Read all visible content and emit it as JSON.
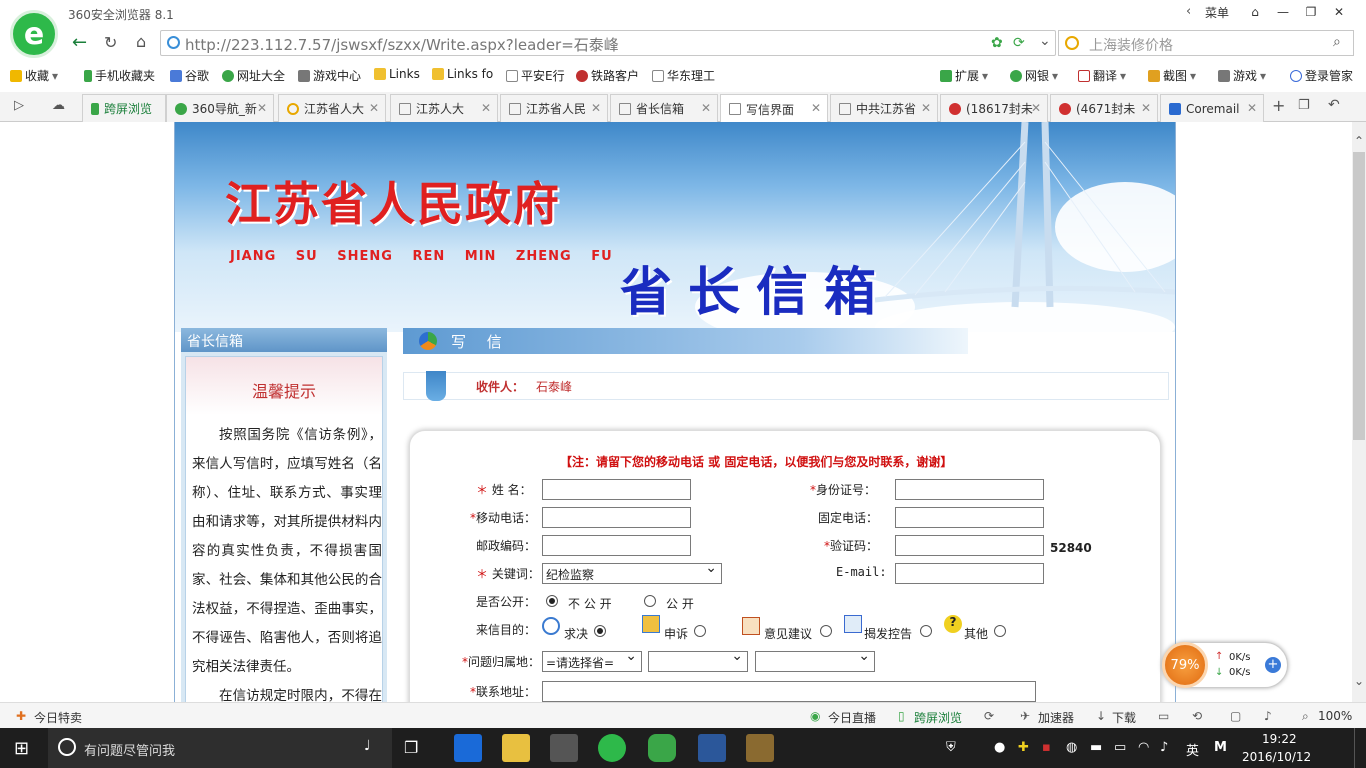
{
  "browser": {
    "app_title": "360安全浏览器 8.1",
    "menu_label": "菜单",
    "url": "http://223.112.7.57/jswsxf/szxx/Write.aspx?leader=石泰峰",
    "search_placeholder": "上海装修价格"
  },
  "bookmarks": {
    "left": [
      "收藏",
      "手机收藏夹",
      "谷歌",
      "网址大全",
      "游戏中心",
      "Links",
      "Links fo",
      "平安E行",
      "铁路客户",
      "华东理工"
    ],
    "right": [
      "扩展",
      "网银",
      "翻译",
      "截图",
      "游戏",
      "登录管家"
    ]
  },
  "tabs": [
    {
      "label": "跨屏浏览",
      "active": false
    },
    {
      "label": "360导航_新",
      "active": false
    },
    {
      "label": "江苏省人大",
      "active": false
    },
    {
      "label": "江苏人大",
      "active": false
    },
    {
      "label": "江苏省人民",
      "active": false
    },
    {
      "label": "省长信箱",
      "active": false
    },
    {
      "label": "写信界面",
      "active": true
    },
    {
      "label": "中共江苏省",
      "active": false
    },
    {
      "label": "(18617封未",
      "active": false
    },
    {
      "label": "(4671封未",
      "active": false
    },
    {
      "label": "Coremail",
      "active": false
    }
  ],
  "banner": {
    "title": "江苏省人民政府",
    "pinyin": "JIANG SU SHENG REN MIN ZHENG FU",
    "box_title": "省长信箱"
  },
  "sidebar": {
    "title": "省长信箱",
    "heading": "温馨提示",
    "paragraph1": "按照国务院《信访条例》，来信人写信时，应填写姓名（名称）、住址、联系方式、事实理由和请求等，对其所提供材料内容的真实性负责，不得损害国家、社会、集体和其他公民的合法权益，不得捏造、歪曲事实，不得诬告、陷害他人，否则将追究相关法律责任。",
    "paragraph2": "在信访规定时限内，不得在其他网络平台上重复发帖、重"
  },
  "write": {
    "bar_label": "写 信",
    "recipient_label": "收件人：",
    "recipient_value": "石泰峰"
  },
  "form": {
    "note": "【注：请留下您的移动电话 或 固定电话，以便我们与您及时联系，谢谢】",
    "name_label": "姓  名：",
    "id_label": "身份证号：",
    "mobile_label": "移动电话：",
    "phone_label": "固定电话：",
    "postcode_label": "邮政编码：",
    "captcha_label": "验证码：",
    "captcha_value": "52840",
    "keyword_label": "关键词：",
    "keyword_value": "纪检监察",
    "email_label": "E-mail:",
    "public_label": "是否公开：",
    "public_no": "不 公 开",
    "public_yes": "公 开",
    "purpose_label": "来信目的：",
    "purpose_options": [
      "求决",
      "申诉",
      "意见建议",
      "揭发控告",
      "其他"
    ],
    "region_label": "问题归属地：",
    "region_value": "=请选择省=",
    "address_label": "联系地址："
  },
  "speed_widget": {
    "percent": "79%",
    "up": "0K/s",
    "down": "0K/s"
  },
  "statusbar": {
    "left": "今日特卖",
    "items": [
      "今日直播",
      "跨屏浏览",
      "加速器",
      "下载"
    ],
    "zoom": "100%"
  },
  "taskbar": {
    "search_placeholder": "有问题尽管问我",
    "ime": "英",
    "time": "19:22",
    "date": "2016/10/12"
  },
  "colors": {
    "accent_red": "#d01010",
    "banner_blue": "#3f88c9",
    "browser_green": "#2eb94a"
  }
}
